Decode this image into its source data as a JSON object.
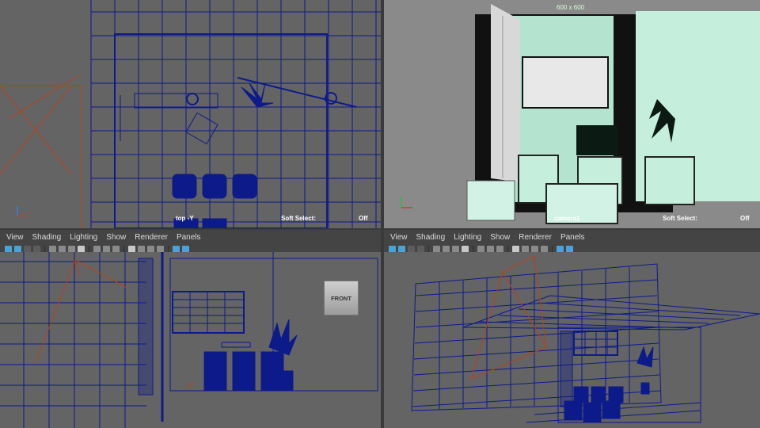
{
  "viewports": {
    "top": {
      "camera_label": "top -Y",
      "soft_select_label": "Soft Select:",
      "soft_select_value": "Off"
    },
    "camera": {
      "camera_label": "camera1",
      "soft_select_label": "Soft Select:",
      "soft_select_value": "Off",
      "resolution_gate": "600 x 600"
    },
    "front": {
      "view_cube_label": "FRONT"
    },
    "persp": {}
  },
  "panel_menus": {
    "left": [
      "View",
      "Shading",
      "Lighting",
      "Show",
      "Renderer",
      "Panels"
    ],
    "right": [
      "View",
      "Shading",
      "Lighting",
      "Show",
      "Renderer",
      "Panels"
    ]
  },
  "icons": {
    "toolbar": [
      "select-camera-icon",
      "lock-camera-icon",
      "bookmark-icon",
      "image-plane-icon",
      "grid-icon",
      "film-gate-icon",
      "resolution-gate-icon",
      "gate-mask-icon",
      "field-chart-icon",
      "safe-action-icon",
      "safe-title-icon",
      "wireframe-icon",
      "smooth-shade-icon",
      "textured-icon",
      "lights-icon",
      "shadows-icon",
      "isolate-select-icon"
    ]
  },
  "colors": {
    "viewport_bg": "#646464",
    "wireframe": "#0d1a8a",
    "camera_frustum": "#b8421c",
    "panel_bar": "#444444"
  }
}
